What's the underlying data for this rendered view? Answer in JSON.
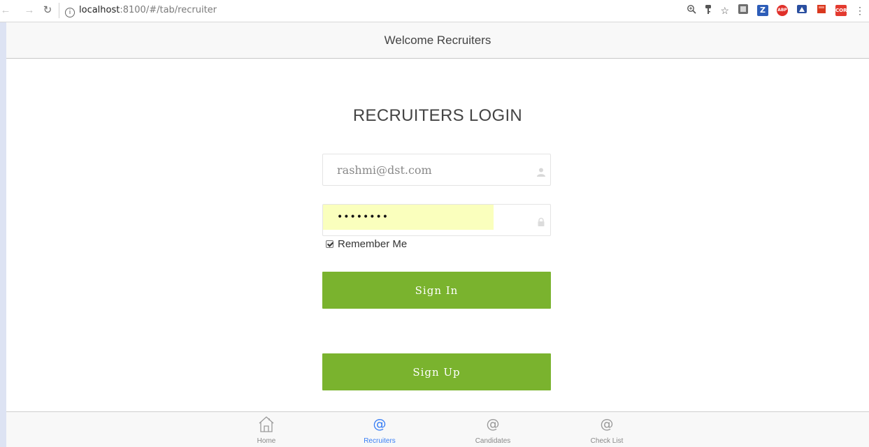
{
  "browser": {
    "url_host": "localhost",
    "url_path": ":8100/#/tab/recruiter",
    "info_glyph": "i"
  },
  "header": {
    "title": "Welcome Recruiters"
  },
  "login": {
    "title": "RECRUITERS LOGIN",
    "email_value": "rashmi@dst.com",
    "password_value": "••••••••",
    "remember_label": "Remember Me",
    "remember_checked": true,
    "signin_label": "Sign In",
    "signup_label": "Sign Up"
  },
  "tabs": [
    {
      "label": "Home",
      "icon": "home-icon",
      "active": false
    },
    {
      "label": "Recruiters",
      "icon": "at-icon",
      "active": true
    },
    {
      "label": "Candidates",
      "icon": "at-icon",
      "active": false
    },
    {
      "label": "Check List",
      "icon": "at-icon",
      "active": false
    }
  ],
  "tab_at_glyph": "@",
  "extensions": [
    {
      "icon": "zoom-icon"
    },
    {
      "icon": "key-icon"
    },
    {
      "icon": "star-icon"
    },
    {
      "icon": "extension-box-icon"
    },
    {
      "icon": "z-extension-icon",
      "text": "Z",
      "color": "#2d5db8"
    },
    {
      "icon": "adblock-icon",
      "text": "ABP",
      "color": "#e0302a"
    },
    {
      "icon": "extension-blue-icon",
      "color": "#2a4fa0"
    },
    {
      "icon": "extension-red-icon",
      "color": "#d9381e"
    },
    {
      "icon": "cors-icon",
      "text": "CORS",
      "color": "#e33a2f"
    },
    {
      "icon": "menu-dots-icon"
    }
  ],
  "colors": {
    "accent_green": "#7ab32e",
    "active_tab_blue": "#387ef5",
    "autofill_yellow": "#faffbd"
  }
}
